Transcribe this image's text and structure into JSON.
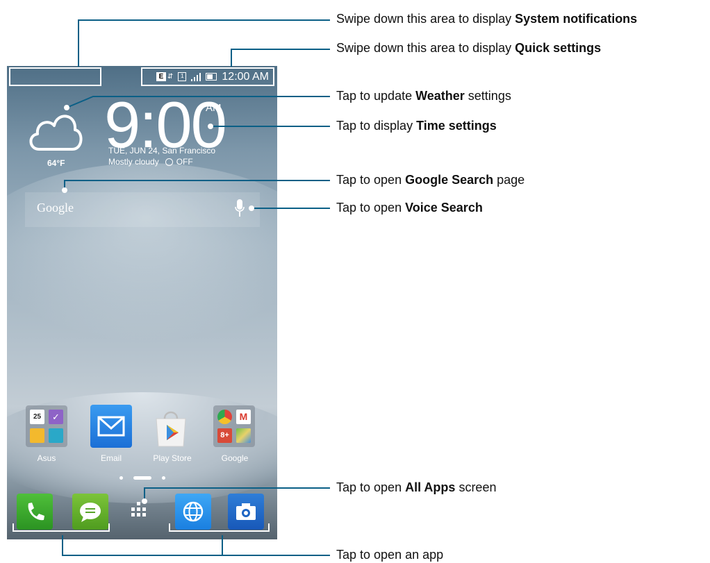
{
  "status_bar": {
    "network_badge": "E",
    "sim_badge": "1",
    "time": "12:00 AM"
  },
  "widget": {
    "time": "9:00",
    "ampm": "AM",
    "date_location": "TUE, JUN 24, San Francisco",
    "condition": "Mostly cloudy",
    "alarm_status": "OFF",
    "temperature": "64°F"
  },
  "search": {
    "google_text": "Google"
  },
  "home_apps": [
    {
      "label": "Asus"
    },
    {
      "label": "Email"
    },
    {
      "label": "Play Store"
    },
    {
      "label": "Google"
    }
  ],
  "asus_folder": {
    "calendar_day": "25"
  },
  "callouts": {
    "notifications": {
      "prefix": "Swipe down this area to display ",
      "bold": "System notifications",
      "suffix": ""
    },
    "quick_settings": {
      "prefix": "Swipe down this area to display ",
      "bold": "Quick settings",
      "suffix": ""
    },
    "weather": {
      "prefix": "Tap to update ",
      "bold": "Weather",
      "suffix": " settings"
    },
    "time": {
      "prefix": "Tap to display ",
      "bold": "Time settings",
      "suffix": ""
    },
    "google_search": {
      "prefix": "Tap to open ",
      "bold": "Google Search",
      "suffix": " page"
    },
    "voice_search": {
      "prefix": "Tap to open ",
      "bold": "Voice Search",
      "suffix": ""
    },
    "all_apps": {
      "prefix": "Tap to open ",
      "bold": "All Apps",
      "suffix": " screen"
    },
    "open_app": {
      "prefix": "Tap to open an app",
      "bold": "",
      "suffix": ""
    }
  },
  "colors": {
    "line": "#0a5f86",
    "phone_accent": "#1b6fd6"
  }
}
